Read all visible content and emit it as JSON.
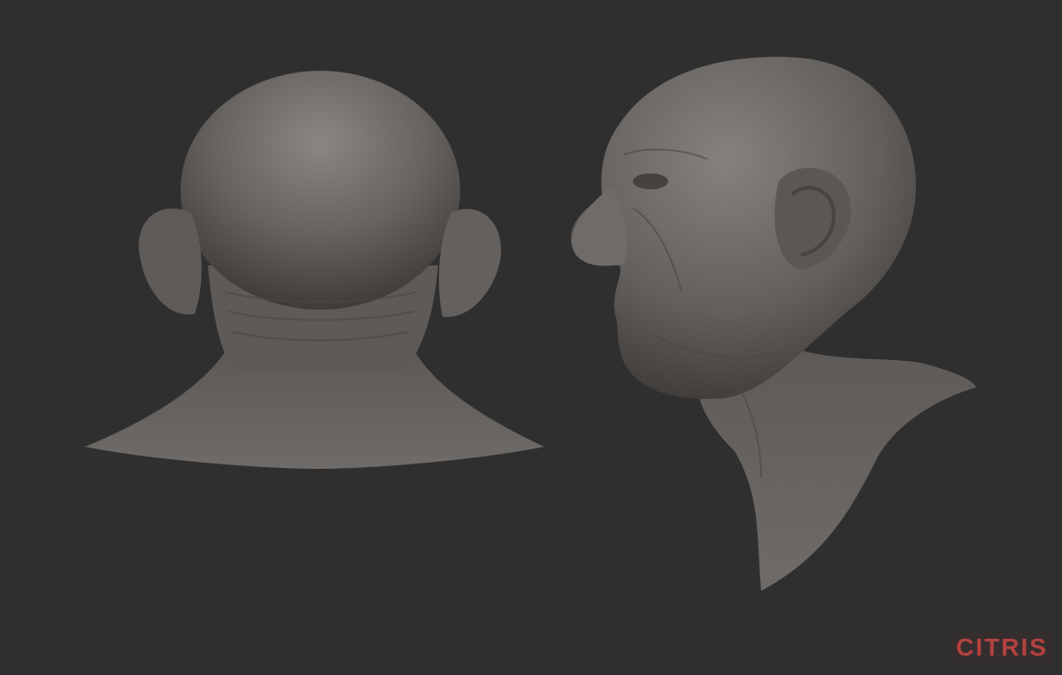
{
  "watermark": {
    "text": "CITRI",
    "tail": "S"
  },
  "colors": {
    "background": "#2f2f2f",
    "clay": "#6e6a67",
    "accent": "#b3413f"
  }
}
